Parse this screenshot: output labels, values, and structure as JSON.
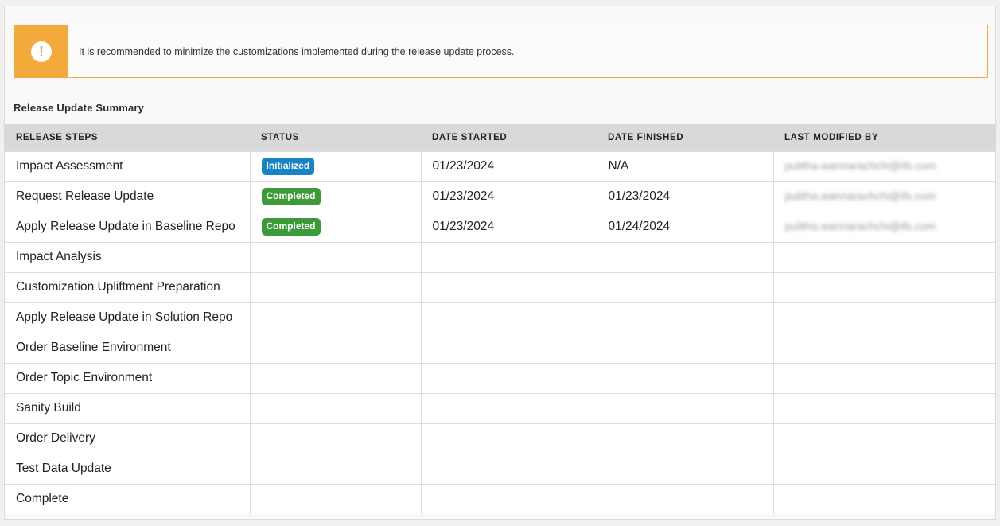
{
  "alert": {
    "icon": "exclamation-icon",
    "message": "It is recommended to minimize the customizations implemented during the release update process.",
    "color": "#f4a93b"
  },
  "section_title": "Release Update Summary",
  "table": {
    "headers": [
      "RELEASE STEPS",
      "STATUS",
      "DATE STARTED",
      "DATE FINISHED",
      "LAST MODIFIED BY"
    ],
    "rows": [
      {
        "step": "Impact Assessment",
        "status": "Initialized",
        "status_color": "#1684c7",
        "started": "01/23/2024",
        "finished": "N/A",
        "modified_by": "pulitha.wannarachchi@ifs.com"
      },
      {
        "step": "Request Release Update",
        "status": "Completed",
        "status_color": "#3c9a39",
        "started": "01/23/2024",
        "finished": "01/23/2024",
        "modified_by": "pulitha.wannarachchi@ifs.com"
      },
      {
        "step": "Apply Release Update in Baseline Repo",
        "status": "Completed",
        "status_color": "#3c9a39",
        "started": "01/23/2024",
        "finished": "01/24/2024",
        "modified_by": "pulitha.wannarachchi@ifs.com"
      },
      {
        "step": "Impact Analysis",
        "status": "",
        "started": "",
        "finished": "",
        "modified_by": ""
      },
      {
        "step": "Customization Upliftment Preparation",
        "status": "",
        "started": "",
        "finished": "",
        "modified_by": ""
      },
      {
        "step": "Apply Release Update in Solution Repo",
        "status": "",
        "started": "",
        "finished": "",
        "modified_by": ""
      },
      {
        "step": "Order Baseline Environment",
        "status": "",
        "started": "",
        "finished": "",
        "modified_by": ""
      },
      {
        "step": "Order Topic Environment",
        "status": "",
        "started": "",
        "finished": "",
        "modified_by": ""
      },
      {
        "step": "Sanity Build",
        "status": "",
        "started": "",
        "finished": "",
        "modified_by": ""
      },
      {
        "step": "Order Delivery",
        "status": "",
        "started": "",
        "finished": "",
        "modified_by": ""
      },
      {
        "step": "Test Data Update",
        "status": "",
        "started": "",
        "finished": "",
        "modified_by": ""
      },
      {
        "step": "Complete",
        "status": "",
        "started": "",
        "finished": "",
        "modified_by": ""
      }
    ]
  }
}
